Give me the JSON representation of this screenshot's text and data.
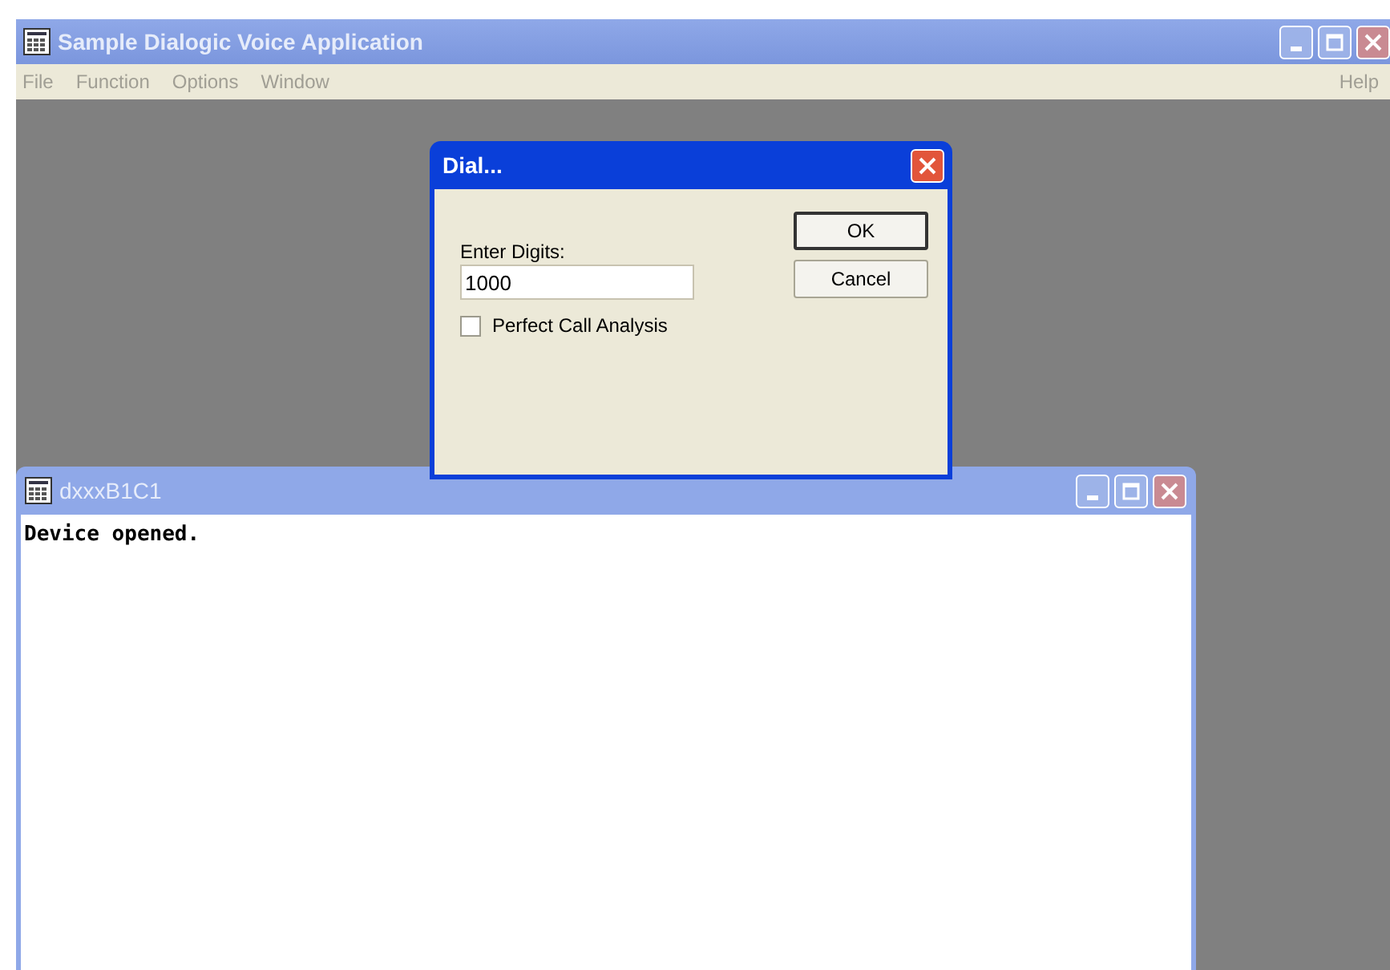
{
  "main_window": {
    "title": "Sample Dialogic Voice Application",
    "menu": [
      "File",
      "Function",
      "Options",
      "Window"
    ],
    "menu_right": "Help"
  },
  "child_window": {
    "title": "dxxxB1C1",
    "content": "Device opened."
  },
  "dialog": {
    "title": "Dial...",
    "field_label": "Enter Digits:",
    "field_value": "1000",
    "checkbox": {
      "label": "Perfect Call Analysis",
      "checked": false
    },
    "buttons": [
      {
        "label": "OK",
        "default": true
      },
      {
        "label": "Cancel",
        "default": false
      }
    ]
  }
}
